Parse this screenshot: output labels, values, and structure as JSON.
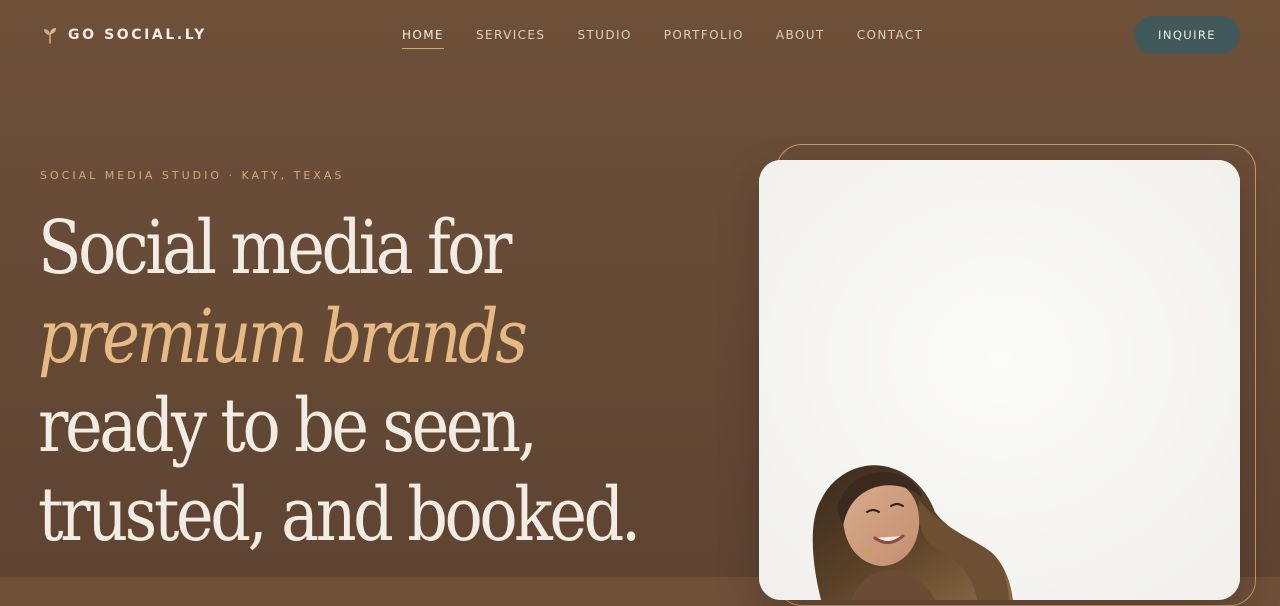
{
  "nav": {
    "brand": "GO SOCIAL.LY",
    "logo_icon": "sprout-icon",
    "items": [
      {
        "label": "HOME",
        "active": true
      },
      {
        "label": "SERVICES",
        "active": false
      },
      {
        "label": "STUDIO",
        "active": false
      },
      {
        "label": "PORTFOLIO",
        "active": false
      },
      {
        "label": "ABOUT",
        "active": false
      },
      {
        "label": "CONTACT",
        "active": false
      }
    ],
    "cta": "INQUIRE"
  },
  "hero": {
    "eyebrow": "SOCIAL MEDIA STUDIO · KATY, TEXAS",
    "headline": {
      "line1": "Social media for",
      "line2": "premium brands",
      "line3": "ready to be seen,",
      "line4": "trusted, and booked."
    }
  },
  "colors": {
    "background": "#684c37",
    "accent": "#e6b985",
    "cta_background": "#41595a",
    "text": "#f3ece4"
  }
}
